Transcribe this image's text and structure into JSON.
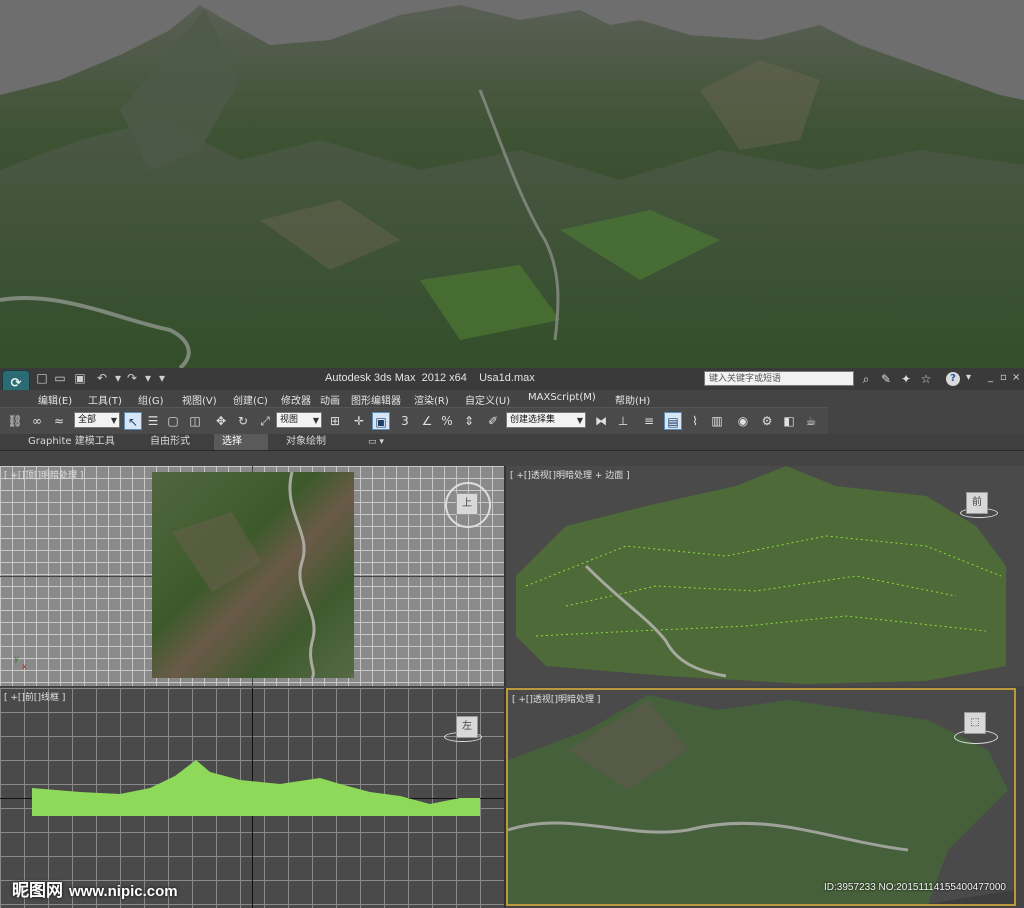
{
  "window": {
    "app_title": "Autodesk 3ds Max  2012 x64",
    "file_name": "Usa1d.max",
    "search_placeholder": "键入关键字或短语"
  },
  "menu": [
    "编辑(E)",
    "工具(T)",
    "组(G)",
    "视图(V)",
    "创建(C)",
    "修改器",
    "动画",
    "图形编辑器",
    "渲染(R)",
    "自定义(U)",
    "MAXScript(M)",
    "帮助(H)"
  ],
  "toolbar": {
    "selection_filter": "全部",
    "reference_coord": "视图",
    "named_selection": "创建选择集",
    "snap_label": "3"
  },
  "ribbon": {
    "tabs": [
      "Graphite 建模工具",
      "自由形式",
      "选择",
      "对象绘制"
    ],
    "active_tab": "选择"
  },
  "viewports": {
    "top": {
      "label": "[ +[]顶[]明暗处理 ]"
    },
    "perspective_edged": {
      "label": "[ +[]透视[]明暗处理 + 边面 ]",
      "cube_face": "前"
    },
    "front": {
      "label": "[ +[]前[]线框 ]",
      "cube_face": "左"
    },
    "perspective": {
      "label": "[ +[]透视[]明暗处理 ]"
    }
  },
  "watermark": {
    "brand": "昵图网",
    "url": "www.nipic.com",
    "id_text": "ID:3957233 NO:20151114155400477000"
  },
  "icons": [
    "app-logo-icon",
    "new-file-icon",
    "open-file-icon",
    "save-icon",
    "undo-icon",
    "redo-icon",
    "binoculars-icon",
    "wrench-icon",
    "star-icon",
    "help-icon",
    "select-icon",
    "move-icon",
    "rotate-icon",
    "scale-icon",
    "render-icon",
    "view-cube-icon"
  ]
}
